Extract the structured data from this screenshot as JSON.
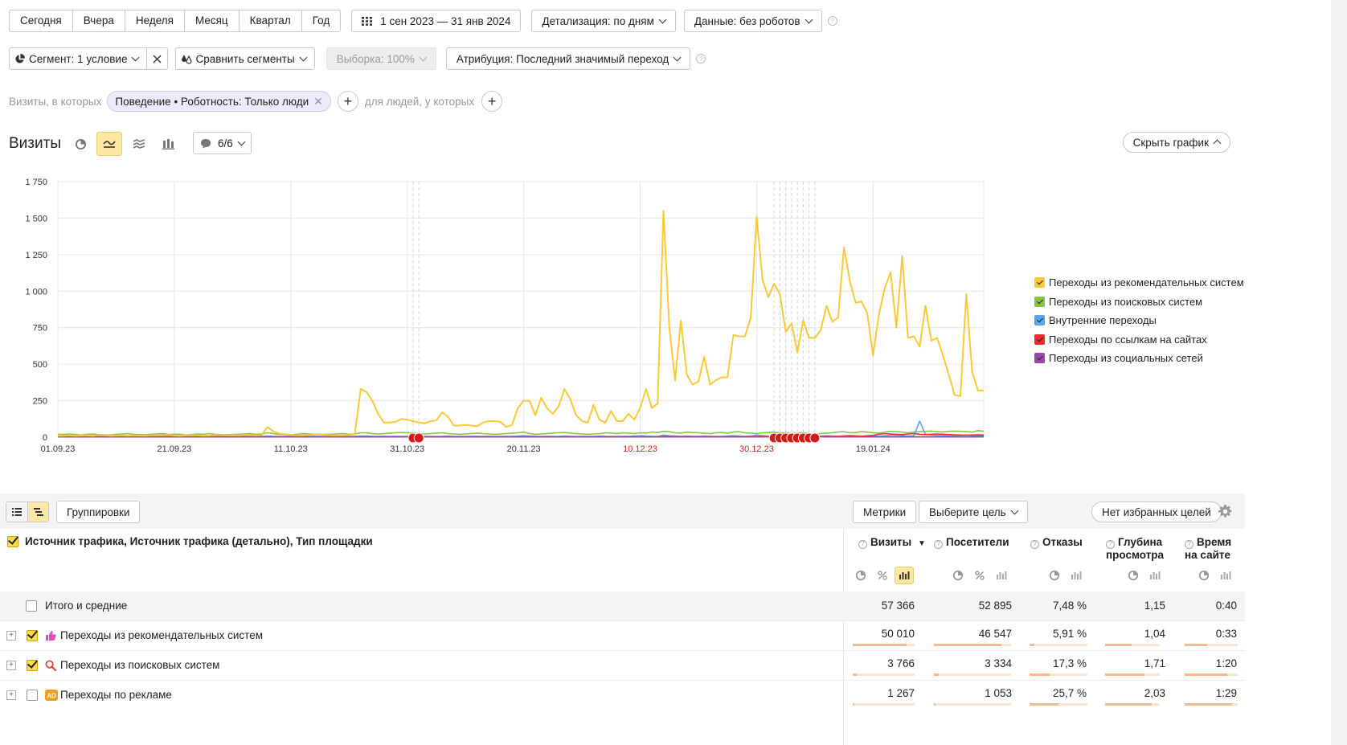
{
  "periods": [
    "Сегодня",
    "Вчера",
    "Неделя",
    "Месяц",
    "Квартал",
    "Год"
  ],
  "date_range": "1 сен 2023 — 31 янв 2024",
  "detail": "Детализация: по дням",
  "data_filter": "Данные: без роботов",
  "segment": "Сегмент: 1 условие",
  "compare": "Сравнить сегменты",
  "sample": "Выборка: 100%",
  "attribution": "Атрибуция: Последний значимый переход",
  "filter_prefix": "Визиты, в которых",
  "filter_chip": "Поведение • Роботность: Только люди",
  "filter_people": "для людей, у которых",
  "chart_title": "Визиты",
  "notes_count": "6/6",
  "hide_chart": "Скрыть график",
  "colors": {
    "recommend": "#fbc837",
    "search": "#87c541",
    "internal": "#58a8e9",
    "links": "#ee2d2d",
    "social": "#9b45b0"
  },
  "chart_data": {
    "type": "line",
    "x_tick_labels": [
      "01.09.23",
      "21.09.23",
      "11.10.23",
      "31.10.23",
      "20.11.23",
      "10.12.23",
      "30.12.23",
      "19.01.24"
    ],
    "holiday_ticks": [
      "10.12.23",
      "30.12.23"
    ],
    "y_tick_labels": [
      "0",
      "250",
      "500",
      "750",
      "1 000",
      "1 250",
      "1 500",
      "1 750"
    ],
    "ylim": [
      0,
      1750
    ],
    "x": [
      "2023-09-01",
      "2024-01-31"
    ],
    "series": [
      {
        "name": "Переходы из рекомендательных систем",
        "color": "#fbc837",
        "values": [
          10,
          10,
          12,
          10,
          11,
          12,
          10,
          15,
          12,
          10,
          11,
          12,
          10,
          12,
          11,
          10,
          12,
          12,
          13,
          15,
          11,
          10,
          12,
          13,
          12,
          10,
          11,
          14,
          15,
          12,
          12,
          12,
          15,
          15,
          12,
          14,
          70,
          40,
          25,
          20,
          15,
          12,
          12,
          15,
          18,
          20,
          15,
          12,
          12,
          12,
          15,
          20,
          330,
          310,
          250,
          160,
          100,
          100,
          105,
          125,
          120,
          110,
          100,
          95,
          110,
          115,
          170,
          140,
          80,
          80,
          85,
          80,
          75,
          100,
          110,
          110,
          105,
          70,
          85,
          200,
          250,
          250,
          150,
          270,
          200,
          160,
          210,
          330,
          260,
          150,
          110,
          100,
          220,
          120,
          100,
          180,
          110,
          110,
          160,
          120,
          200,
          330,
          200,
          230,
          1550,
          750,
          390,
          800,
          430,
          360,
          380,
          550,
          360,
          390,
          410,
          410,
          700,
          690,
          690,
          820,
          1510,
          1080,
          960,
          1050,
          980,
          720,
          780,
          580,
          800,
          680,
          680,
          730,
          900,
          790,
          820,
          1300,
          1070,
          920,
          930,
          850,
          560,
          840,
          1020,
          1130,
          750,
          1240,
          680,
          690,
          620,
          900,
          660,
          680,
          560,
          430,
          290,
          280,
          980,
          450,
          320,
          320
        ]
      },
      {
        "name": "Переходы из поисковых систем",
        "color": "#87c541",
        "values": [
          20,
          18,
          22,
          18,
          15,
          20,
          22,
          18,
          16,
          15,
          20,
          22,
          25,
          20,
          18,
          16,
          20,
          22,
          25,
          18,
          20,
          20,
          15,
          18,
          22,
          20,
          25,
          20,
          18,
          16,
          18,
          20,
          22,
          25,
          20,
          22,
          30,
          25,
          20,
          18,
          15,
          20,
          25,
          22,
          20,
          18,
          20,
          20,
          22,
          25,
          20,
          22,
          30,
          30,
          25,
          22,
          25,
          28,
          30,
          32,
          30,
          28,
          25,
          22,
          25,
          28,
          30,
          25,
          22,
          20,
          22,
          25,
          28,
          25,
          22,
          20,
          22,
          25,
          28,
          30,
          35,
          25,
          20,
          22,
          25,
          28,
          30,
          32,
          28,
          25,
          22,
          20,
          22,
          25,
          30,
          28,
          25,
          30,
          28,
          25,
          30,
          28,
          35,
          32,
          40,
          38,
          30,
          28,
          35,
          32,
          30,
          28,
          25,
          30,
          32,
          28,
          35,
          38,
          30,
          28,
          25,
          30,
          32,
          35,
          28,
          30,
          25,
          28,
          30,
          25,
          22,
          25,
          28,
          30,
          35,
          38,
          30,
          32,
          38,
          35,
          30,
          28,
          35,
          40,
          38,
          35,
          30,
          35,
          38,
          40,
          42,
          38,
          35,
          40,
          42,
          40,
          38,
          35,
          45,
          40
        ]
      },
      {
        "name": "Внутренние переходы",
        "color": "#58a8e9",
        "values": [
          5,
          5,
          6,
          5,
          4,
          5,
          6,
          5,
          4,
          5,
          6,
          5,
          5,
          6,
          5,
          4,
          5,
          6,
          5,
          5,
          6,
          5,
          4,
          5,
          6,
          5,
          5,
          6,
          5,
          4,
          5,
          6,
          5,
          5,
          6,
          5,
          8,
          6,
          5,
          5,
          6,
          5,
          4,
          5,
          6,
          5,
          5,
          6,
          5,
          4,
          5,
          6,
          8,
          8,
          6,
          5,
          6,
          5,
          6,
          5,
          5,
          6,
          5,
          6,
          5,
          5,
          6,
          8,
          6,
          5,
          5,
          6,
          5,
          5,
          6,
          5,
          5,
          6,
          5,
          8,
          10,
          8,
          6,
          5,
          6,
          5,
          6,
          8,
          6,
          5,
          6,
          5,
          6,
          8,
          6,
          5,
          5,
          6,
          5,
          8,
          10,
          8,
          6,
          5,
          15,
          10,
          8,
          6,
          8,
          6,
          5,
          8,
          6,
          5,
          6,
          8,
          10,
          8,
          6,
          8,
          15,
          10,
          8,
          10,
          8,
          6,
          8,
          6,
          10,
          8,
          6,
          8,
          10,
          8,
          6,
          10,
          12,
          10,
          8,
          6,
          8,
          6,
          10,
          15,
          12,
          10,
          8,
          10,
          110,
          20,
          15,
          12,
          10,
          8,
          10,
          12,
          15,
          10,
          8,
          10
        ]
      },
      {
        "name": "Переходы по ссылкам на сайтах",
        "color": "#ee2d2d",
        "values": [
          3,
          3,
          3,
          3,
          3,
          3,
          3,
          3,
          3,
          3,
          3,
          3,
          3,
          3,
          3,
          3,
          3,
          3,
          3,
          3,
          3,
          3,
          3,
          3,
          3,
          3,
          3,
          3,
          3,
          3,
          3,
          3,
          3,
          3,
          3,
          3,
          3,
          3,
          3,
          3,
          3,
          3,
          3,
          3,
          3,
          3,
          3,
          3,
          3,
          3,
          3,
          3,
          3,
          3,
          3,
          3,
          3,
          3,
          3,
          3,
          3,
          3,
          3,
          3,
          3,
          3,
          3,
          3,
          3,
          3,
          3,
          3,
          3,
          3,
          3,
          3,
          3,
          3,
          3,
          3,
          3,
          3,
          3,
          3,
          3,
          3,
          3,
          3,
          3,
          3,
          3,
          3,
          3,
          3,
          3,
          3,
          3,
          3,
          3,
          3,
          3,
          3,
          3,
          3,
          5,
          5,
          4,
          4,
          4,
          4,
          4,
          4,
          4,
          4,
          4,
          4,
          4,
          4,
          4,
          4,
          5,
          5,
          4,
          4,
          4,
          4,
          4,
          4,
          4,
          4,
          4,
          5,
          5,
          5,
          5,
          6,
          6,
          6,
          6,
          10,
          12,
          20,
          25,
          22,
          20,
          18,
          22,
          25,
          20,
          18,
          20,
          22,
          20,
          18,
          16,
          15,
          14,
          15,
          16,
          15
        ]
      },
      {
        "name": "Переходы из социальных сетей",
        "color": "#9b45b0",
        "values": [
          2,
          2,
          2,
          2,
          2,
          2,
          2,
          2,
          2,
          2,
          2,
          2,
          2,
          2,
          2,
          2,
          2,
          2,
          2,
          2,
          2,
          2,
          2,
          2,
          2,
          2,
          2,
          2,
          2,
          2,
          2,
          2,
          2,
          2,
          2,
          2,
          2,
          2,
          2,
          2,
          2,
          2,
          2,
          2,
          2,
          2,
          2,
          2,
          2,
          2,
          2,
          2,
          2,
          2,
          2,
          2,
          2,
          2,
          2,
          2,
          2,
          2,
          2,
          2,
          2,
          2,
          2,
          2,
          2,
          2,
          2,
          2,
          2,
          2,
          2,
          2,
          2,
          2,
          2,
          2,
          2,
          2,
          2,
          2,
          2,
          2,
          2,
          2,
          2,
          2,
          2,
          2,
          2,
          2,
          2,
          2,
          2,
          2,
          2,
          2,
          2,
          2,
          2,
          2,
          2,
          2,
          2,
          2,
          2,
          2,
          2,
          2,
          2,
          2,
          2,
          2,
          2,
          2,
          2,
          2,
          2,
          2,
          2,
          2,
          2,
          2,
          2,
          2,
          2,
          2,
          2,
          2,
          2,
          2,
          2,
          2,
          2,
          2,
          2,
          2,
          2,
          2,
          2,
          2,
          2,
          2,
          2,
          2,
          2,
          2,
          2,
          2,
          2,
          2,
          2,
          2,
          2,
          2,
          2,
          2
        ]
      }
    ],
    "grid": true,
    "legend": "right"
  },
  "table": {
    "view_toggle_icons": [
      "list-icon",
      "tree-icon"
    ],
    "groupings": "Группировки",
    "metrics": "Метрики",
    "goal": "Выберите цель",
    "favorites": "Нет избранных целей",
    "dimension_header": "Источник трафика, Источник трафика (детально), Тип площадки",
    "columns": [
      {
        "label": "Визиты",
        "sort": "▼"
      },
      {
        "label": "Посетители"
      },
      {
        "label": "Отказы"
      },
      {
        "label": "Глубина просмотра"
      },
      {
        "label": "Время на сайте"
      }
    ],
    "total": {
      "label": "Итого и средние",
      "values": [
        "57 366",
        "52 895",
        "7,48 %",
        "1,15",
        "0:40"
      ]
    },
    "rows": [
      {
        "label": "Переходы из рекомендательных систем",
        "icon": "thumbs-up-icon",
        "values": [
          "50 010",
          "46 547",
          "5,91 %",
          "1,04",
          "0:33"
        ],
        "bars": [
          0.872,
          0.88,
          0.09,
          0.48,
          0.42
        ]
      },
      {
        "label": "Переходы из поисковых систем",
        "icon": "search-icon",
        "values": [
          "3 766",
          "3 334",
          "17,3 %",
          "1,71",
          "1:20"
        ],
        "bars": [
          0.066,
          0.063,
          0.35,
          0.72,
          0.8
        ]
      },
      {
        "label": "Переходы по рекламе",
        "icon": "ad-icon",
        "values": [
          "1 267",
          "1 053",
          "25,7 %",
          "2,03",
          "1:29"
        ],
        "bars": [
          0.02,
          0.02,
          0.5,
          0.85,
          0.9
        ]
      }
    ]
  }
}
